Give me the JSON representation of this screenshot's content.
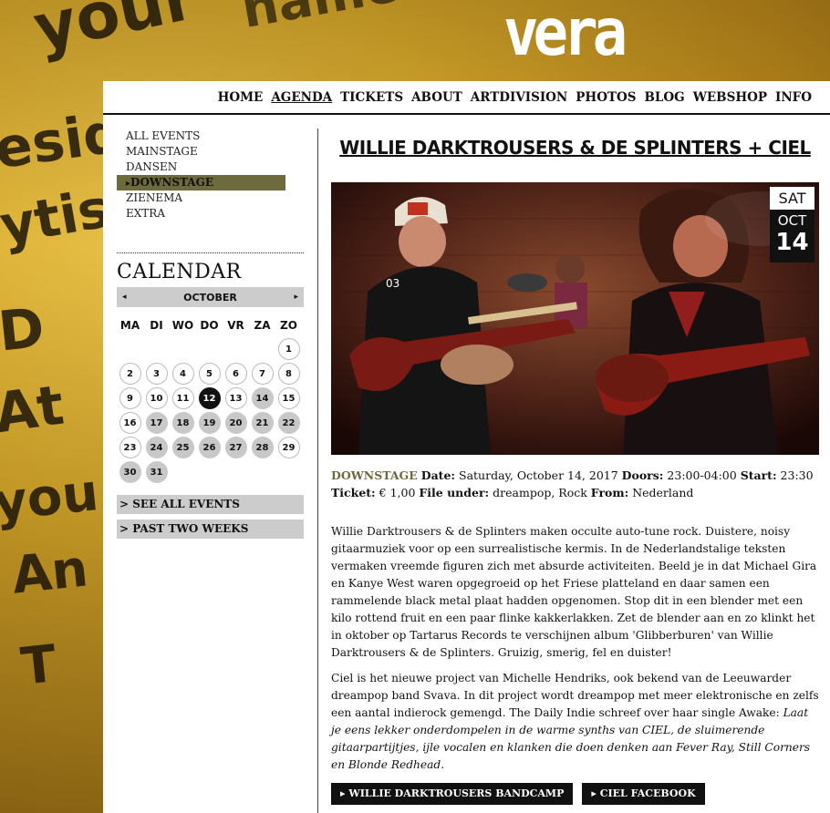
{
  "site": {
    "logo": "vera"
  },
  "nav": {
    "items": [
      {
        "label": "HOME",
        "active": false
      },
      {
        "label": "AGENDA",
        "active": true
      },
      {
        "label": "TICKETS",
        "active": false
      },
      {
        "label": "ABOUT",
        "active": false
      },
      {
        "label": "ARTDIVISION",
        "active": false
      },
      {
        "label": "PHOTOS",
        "active": false
      },
      {
        "label": "BLOG",
        "active": false
      },
      {
        "label": "WEBSHOP",
        "active": false
      },
      {
        "label": "INFO",
        "active": false
      }
    ]
  },
  "sidebar": {
    "categories": [
      {
        "label": "ALL EVENTS",
        "active": false
      },
      {
        "label": "MAINSTAGE",
        "active": false
      },
      {
        "label": "DANSEN",
        "active": false
      },
      {
        "label": "DOWNSTAGE",
        "active": true
      },
      {
        "label": "ZIENEMA",
        "active": false
      },
      {
        "label": "EXTRA",
        "active": false
      }
    ],
    "calendar": {
      "title": "CALENDAR",
      "month": "OCTOBER",
      "prev_arrow": "◂",
      "next_arrow": "▸",
      "weekdays": [
        "MA",
        "DI",
        "WO",
        "DO",
        "VR",
        "ZA",
        "ZO"
      ],
      "leading_blanks": 6,
      "days": [
        {
          "n": "1",
          "state": "plain"
        },
        {
          "n": "2",
          "state": "plain"
        },
        {
          "n": "3",
          "state": "plain"
        },
        {
          "n": "4",
          "state": "plain"
        },
        {
          "n": "5",
          "state": "plain"
        },
        {
          "n": "6",
          "state": "plain"
        },
        {
          "n": "7",
          "state": "plain"
        },
        {
          "n": "8",
          "state": "plain"
        },
        {
          "n": "9",
          "state": "plain"
        },
        {
          "n": "10",
          "state": "plain"
        },
        {
          "n": "11",
          "state": "plain"
        },
        {
          "n": "12",
          "state": "today"
        },
        {
          "n": "13",
          "state": "plain"
        },
        {
          "n": "14",
          "state": "event"
        },
        {
          "n": "15",
          "state": "plain"
        },
        {
          "n": "16",
          "state": "plain"
        },
        {
          "n": "17",
          "state": "event"
        },
        {
          "n": "18",
          "state": "event"
        },
        {
          "n": "19",
          "state": "event"
        },
        {
          "n": "20",
          "state": "event"
        },
        {
          "n": "21",
          "state": "event"
        },
        {
          "n": "22",
          "state": "event"
        },
        {
          "n": "23",
          "state": "plain"
        },
        {
          "n": "24",
          "state": "event"
        },
        {
          "n": "25",
          "state": "event"
        },
        {
          "n": "26",
          "state": "event"
        },
        {
          "n": "27",
          "state": "event"
        },
        {
          "n": "28",
          "state": "event"
        },
        {
          "n": "29",
          "state": "plain"
        },
        {
          "n": "30",
          "state": "event"
        },
        {
          "n": "31",
          "state": "event"
        }
      ]
    },
    "see_all": "> SEE ALL EVENTS",
    "past_two_weeks": "> PAST TWO WEEKS"
  },
  "event": {
    "title": "WILLIE DARKTROUSERS & DE SPLINTERS + CIEL",
    "date_badge": {
      "weekday": "SAT",
      "month": "OCT",
      "day": "14"
    },
    "venue": "DOWNSTAGE",
    "date_label": "Date:",
    "date_value": "Saturday, October 14, 2017",
    "doors_label": "Doors:",
    "doors_value": "23:00-04:00",
    "start_label": "Start:",
    "start_value": "23:30",
    "ticket_label": "Ticket:",
    "ticket_value": "€ 1,00",
    "file_under_label": "File under:",
    "file_under_value": "dreampop, Rock",
    "from_label": "From:",
    "from_value": "Nederland",
    "paragraph1": "Willie Darktrousers & de Splinters maken occulte auto-tune rock. Duistere, noisy gitaarmuziek voor op een surrealistische kermis. In de Nederlandstalige teksten vermaken vreemde figuren zich met absurde activiteiten. Beeld je in dat Michael Gira en Kanye West waren opgegroeid op het Friese platteland en daar samen een rammelende black metal plaat hadden opgenomen. Stop dit in een blender met een kilo rottend fruit en een paar flinke kakkerlakken. Zet de blender aan en zo klinkt het in oktober op Tartarus Records te verschijnen album 'Glibberburen' van Willie Darktrousers & de Splinters. Gruizig, smerig, fel en duister!",
    "paragraph2_plain": "Ciel is het nieuwe project van Michelle Hendriks, ook bekend van de Leeuwarder dreampop band Svava. In dit project wordt dreampop met meer elektronische en zelfs een aantal indierock gemengd. The Daily Indie schreef over haar single Awake: ",
    "paragraph2_quote": "Laat je eens lekker onderdompelen in de warme synths van CIEL, de sluimerende gitaarpartijtjes, ijle vocalen en klanken die doen denken aan Fever Ray, Still Corners en Blonde Redhead",
    "paragraph2_end": ".",
    "link1": "▸ WILLIE DARKTROUSERS BANDCAMP",
    "link2": "▸ CIEL FACEBOOK"
  }
}
